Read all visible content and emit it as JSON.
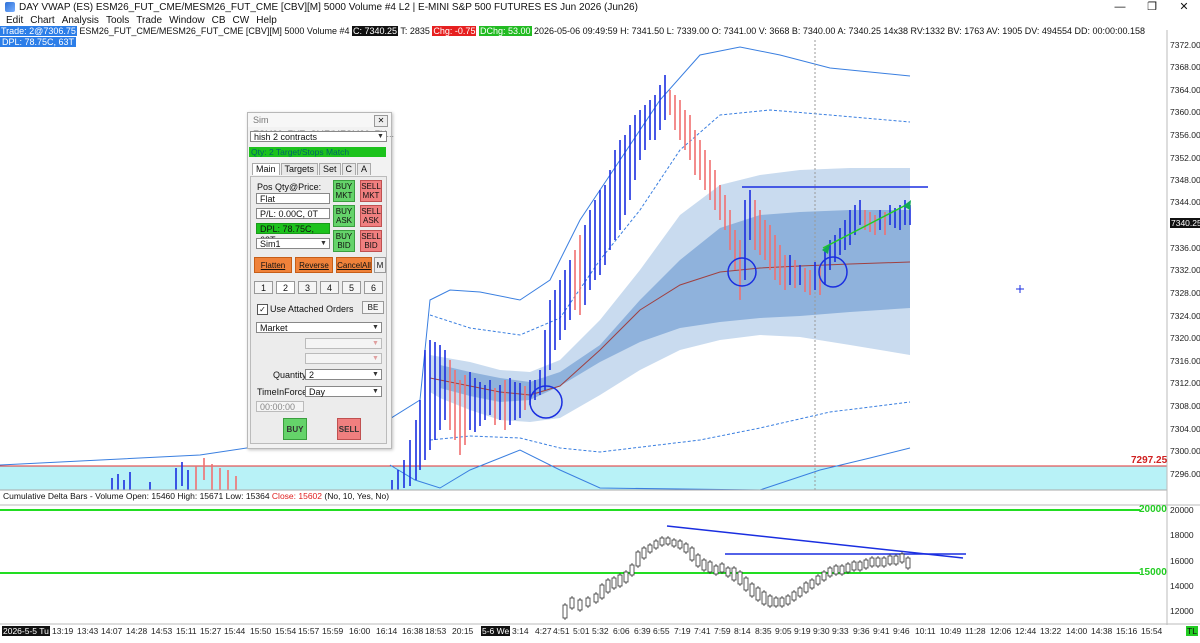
{
  "window": {
    "title": "DAY VWAP (ES) ESM26_FUT_CME/MESM26_FUT_CME [CBV][M]  5000 Volume #4 L2 | E-MINI S&P 500 FUTURES ES Jun 2026 (Jun26)"
  },
  "menu": [
    "Edit",
    "Chart",
    "Analysis",
    "Tools",
    "Trade",
    "Window",
    "CB",
    "CW",
    "Help"
  ],
  "infobar": {
    "trade": "Trade: 2@7306.75",
    "symbol": "ESM26_FUT_CME/MESM26_FUT_CME [CBV][M]  5000 Volume #4",
    "last": "C: 7340.25",
    "ticks": "T: 2835",
    "chg": "Chg: -0.75",
    "dchg": "DChg: 53.00",
    "rest": "2026-05-06 09:49:59 H: 7341.50 L: 7339.00 O: 7341.00 V: 3668 B: 7340.00 A: 7340.25 14x38 RV:1332 BV: 1763 AV: 1905 DV: 494554 DD: 00:00:00.158"
  },
  "dpl_line": "DPL: 78.75C, 63T",
  "colors": {
    "upbar": "#1a2ee0",
    "downbar": "#f07070",
    "band_outer": "#c7d9ee",
    "band_inner": "#8fb2dc",
    "vwap": "#a04040",
    "cyan_zone": "#b8f2f7",
    "green_line": "#22dd22",
    "trend_blue": "#1a2ee0"
  },
  "panel": {
    "title": "Sim ESM26_FUT_CME/MESM26_FU...",
    "account_dropdown": "hish 2 contracts",
    "status": "Qty: 2 Target/Stops Match",
    "tabs": [
      "Main",
      "Targets",
      "Set",
      "C",
      "A"
    ],
    "pos_label": "Pos Qty@Price:",
    "pos_value": "Flat",
    "pl_value": "P/L: 0.00C, 0T",
    "dpl_value": "DPL: 78.75C, 63T",
    "account": "Sim1",
    "buy_mkt": [
      "BUY",
      "MKT"
    ],
    "sell_mkt": [
      "SELL",
      "MKT"
    ],
    "buy_ask": [
      "BUY",
      "ASK"
    ],
    "sell_ask": [
      "SELL",
      "ASK"
    ],
    "buy_bid": [
      "BUY",
      "BID"
    ],
    "sell_bid": [
      "SELL",
      "BID"
    ],
    "flatten": "Flatten",
    "reverse": "Reverse",
    "cancel_all": "CancelAll",
    "m": "M",
    "number_tabs": [
      "1",
      "2",
      "3",
      "4",
      "5",
      "6"
    ],
    "use_attached": "Use Attached Orders",
    "be": "BE",
    "order_type": "Market",
    "quantity_label": "Quantity:",
    "quantity": "2",
    "tif_label": "TimeInForce:",
    "tif": "Day",
    "time": "00:00:00",
    "buy": "BUY",
    "sell": "SELL"
  },
  "price_axis": [
    "7372.00",
    "7368.00",
    "7364.00",
    "7360.00",
    "7356.00",
    "7352.00",
    "7348.00",
    "7344.00",
    "7340.25",
    "7336.00",
    "7332.00",
    "7328.00",
    "7324.00",
    "7320.00",
    "7316.00",
    "7312.00",
    "7308.00",
    "7304.00",
    "7300.00",
    "7296.00"
  ],
  "price_marker": "7297.25",
  "lower_study": {
    "label": "Cumulative Delta Bars - Volume",
    "open": "Open: 15460",
    "high": "High: 15671",
    "low": "Low: 15364",
    "close": "Close: 15602",
    "params": "(No, 10, Yes, No)",
    "axis": [
      "20000",
      "18000",
      "16000",
      "14000",
      "12000"
    ],
    "line_hi": "20000",
    "line_lo": "15000"
  },
  "time_axis": {
    "date1": "2026-5-5 Tu",
    "times1": [
      "13:19",
      "13:43",
      "14:07",
      "14:28",
      "14:53",
      "15:11",
      "15:27",
      "15:44",
      "15:50",
      "15:54",
      "15:57",
      "15:59",
      "16:00",
      "16:14",
      "16:38",
      "18:53",
      "20:15"
    ],
    "date2": "5-6 We",
    "times2": [
      "3:14",
      "4:27",
      "4:51",
      "5:01",
      "5:32",
      "6:06",
      "6:39",
      "6:55",
      "7:19",
      "7:41",
      "7:59",
      "8:14",
      "8:35",
      "9:05",
      "9:19",
      "9:30",
      "9:33",
      "9:36",
      "9:41",
      "9:46",
      "10:11",
      "10:49",
      "11:28",
      "12:06",
      "12:44",
      "13:22",
      "14:00",
      "14:38",
      "15:16",
      "15:54"
    ],
    "tl": "TL"
  }
}
